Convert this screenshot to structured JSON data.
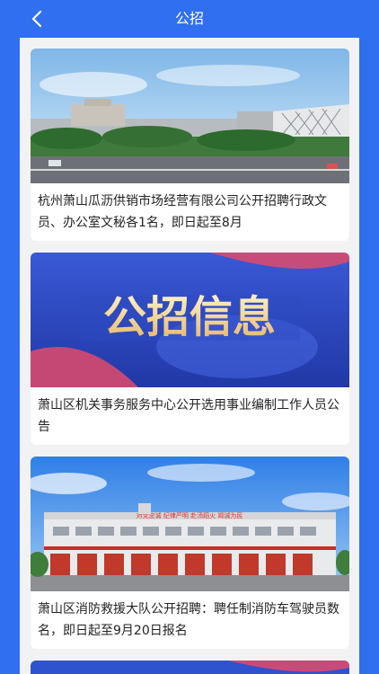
{
  "header": {
    "title": "公招",
    "back_icon": "chevron-left-icon"
  },
  "colors": {
    "accent": "#2f6ff0"
  },
  "articles": [
    {
      "title": "杭州萧山瓜沥供销市场经营有限公司公开招聘行政文员、办公室文秘各1名，即日起至8月"
    },
    {
      "title": "萧山区机关事务服务中心公开选用事业编制工作人员公告",
      "banner_text": "公招信息"
    },
    {
      "title": "萧山区消防救援大队公开招聘：聘任制消防车驾驶员数名，即日起至9月20日报名",
      "building_slogan": "对党忠诚  纪律严明  赴汤蹈火  竭诚为民"
    }
  ]
}
